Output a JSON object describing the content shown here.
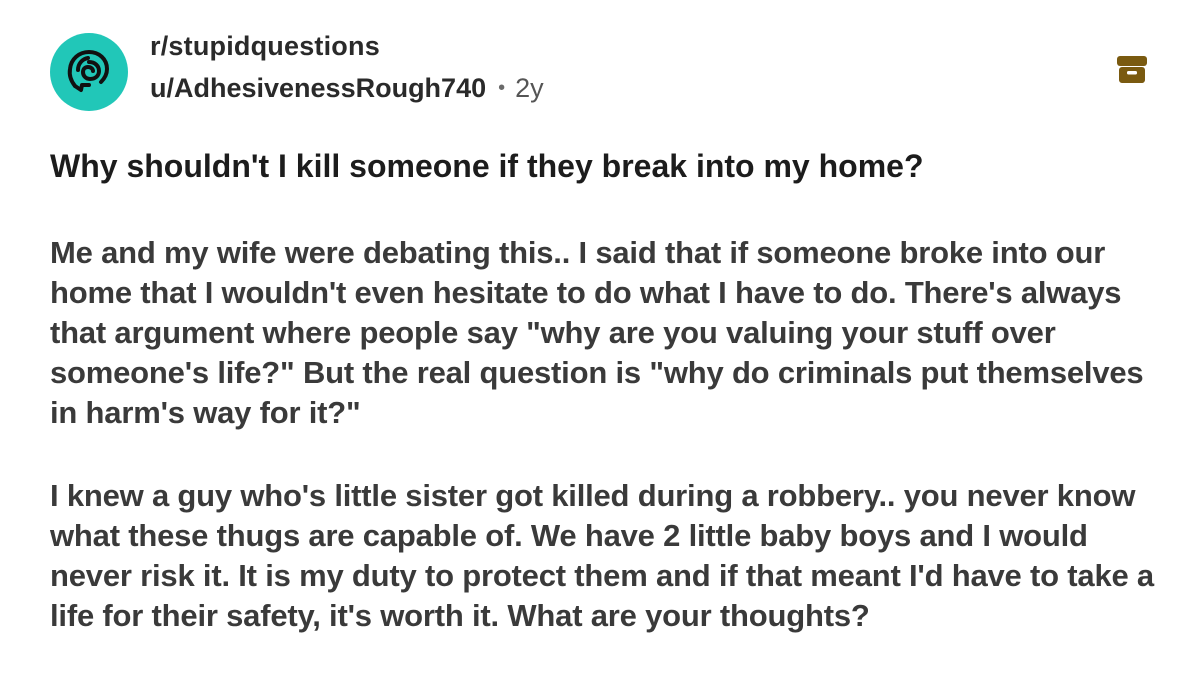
{
  "post": {
    "subreddit": "r/stupidquestions",
    "username": "u/AdhesivenessRough740",
    "separator": "•",
    "age": "2y",
    "title": "Why shouldn't I kill someone if they break into my home?",
    "paragraphs": [
      "Me and my wife were debating this.. I said that if someone broke into our home that I wouldn't even hesitate to do what I have to do. There's always that argument where people say \"why are you valuing your stuff over someone's life?\" But the real question is \"why do criminals put themselves in harm's way for it?\"",
      "I knew a guy who's little sister got killed during a robbery.. you never know what these thugs are capable of. We have 2 little baby boys and I would never risk it. It is my duty to protect them and if that meant I'd have to take a life for their safety, it's worth it. What are your thoughts?"
    ]
  },
  "icons": {
    "avatar": "subreddit-head-icon",
    "archive": "archive-box-icon"
  },
  "colors": {
    "avatar_bg": "#21c7b8",
    "archive_icon": "#7a5a10",
    "text": "#1c1c1c",
    "body_text": "#3a3a3a"
  }
}
